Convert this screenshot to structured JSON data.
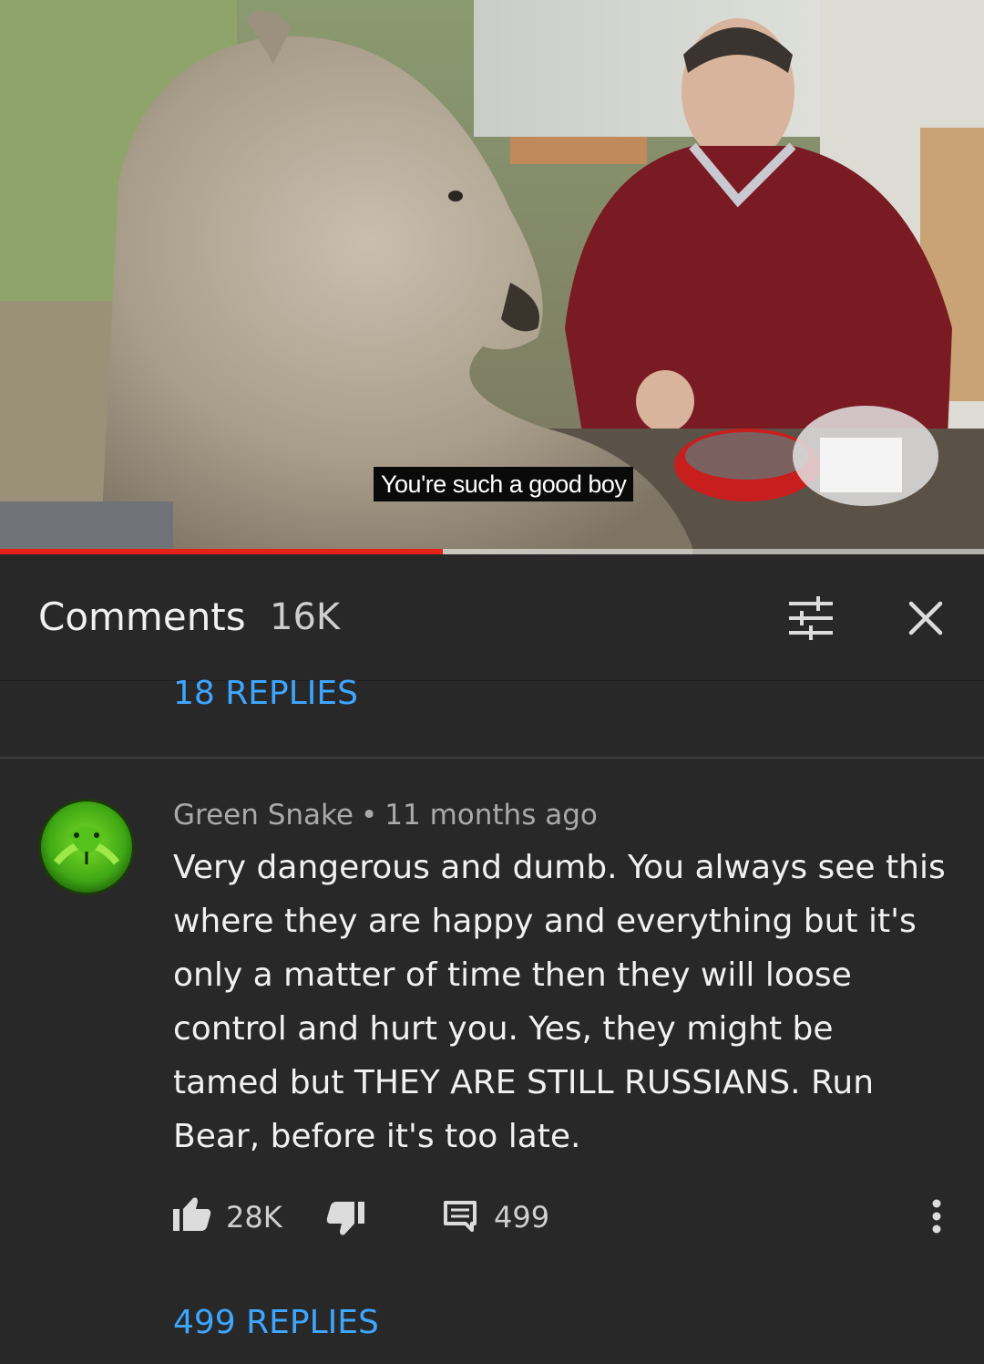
{
  "video": {
    "caption": "You're such a good boy",
    "progress": 0.45
  },
  "comments_panel": {
    "title": "Comments",
    "count": "16K",
    "filter_icon": "sort-sliders-icon",
    "close_icon": "close-icon"
  },
  "previous_thread": {
    "replies_label": "18 REPLIES"
  },
  "comment": {
    "author": "Green Snake",
    "separator": "•",
    "time": "11 months ago",
    "text": "Very dangerous and dumb. You always see this where they are happy and everything but it's only a matter of time then they will loose control and hurt you. Yes, they might be tamed but THEY ARE STILL RUSSIANS. Run Bear, before it's too late.",
    "likes": "28K",
    "reply_count": "499",
    "replies_label": "499 REPLIES",
    "avatar_icon": "green-snake-avatar"
  },
  "colors": {
    "background": "#282828",
    "link": "#3ea6ff",
    "progress": "#e62117"
  }
}
